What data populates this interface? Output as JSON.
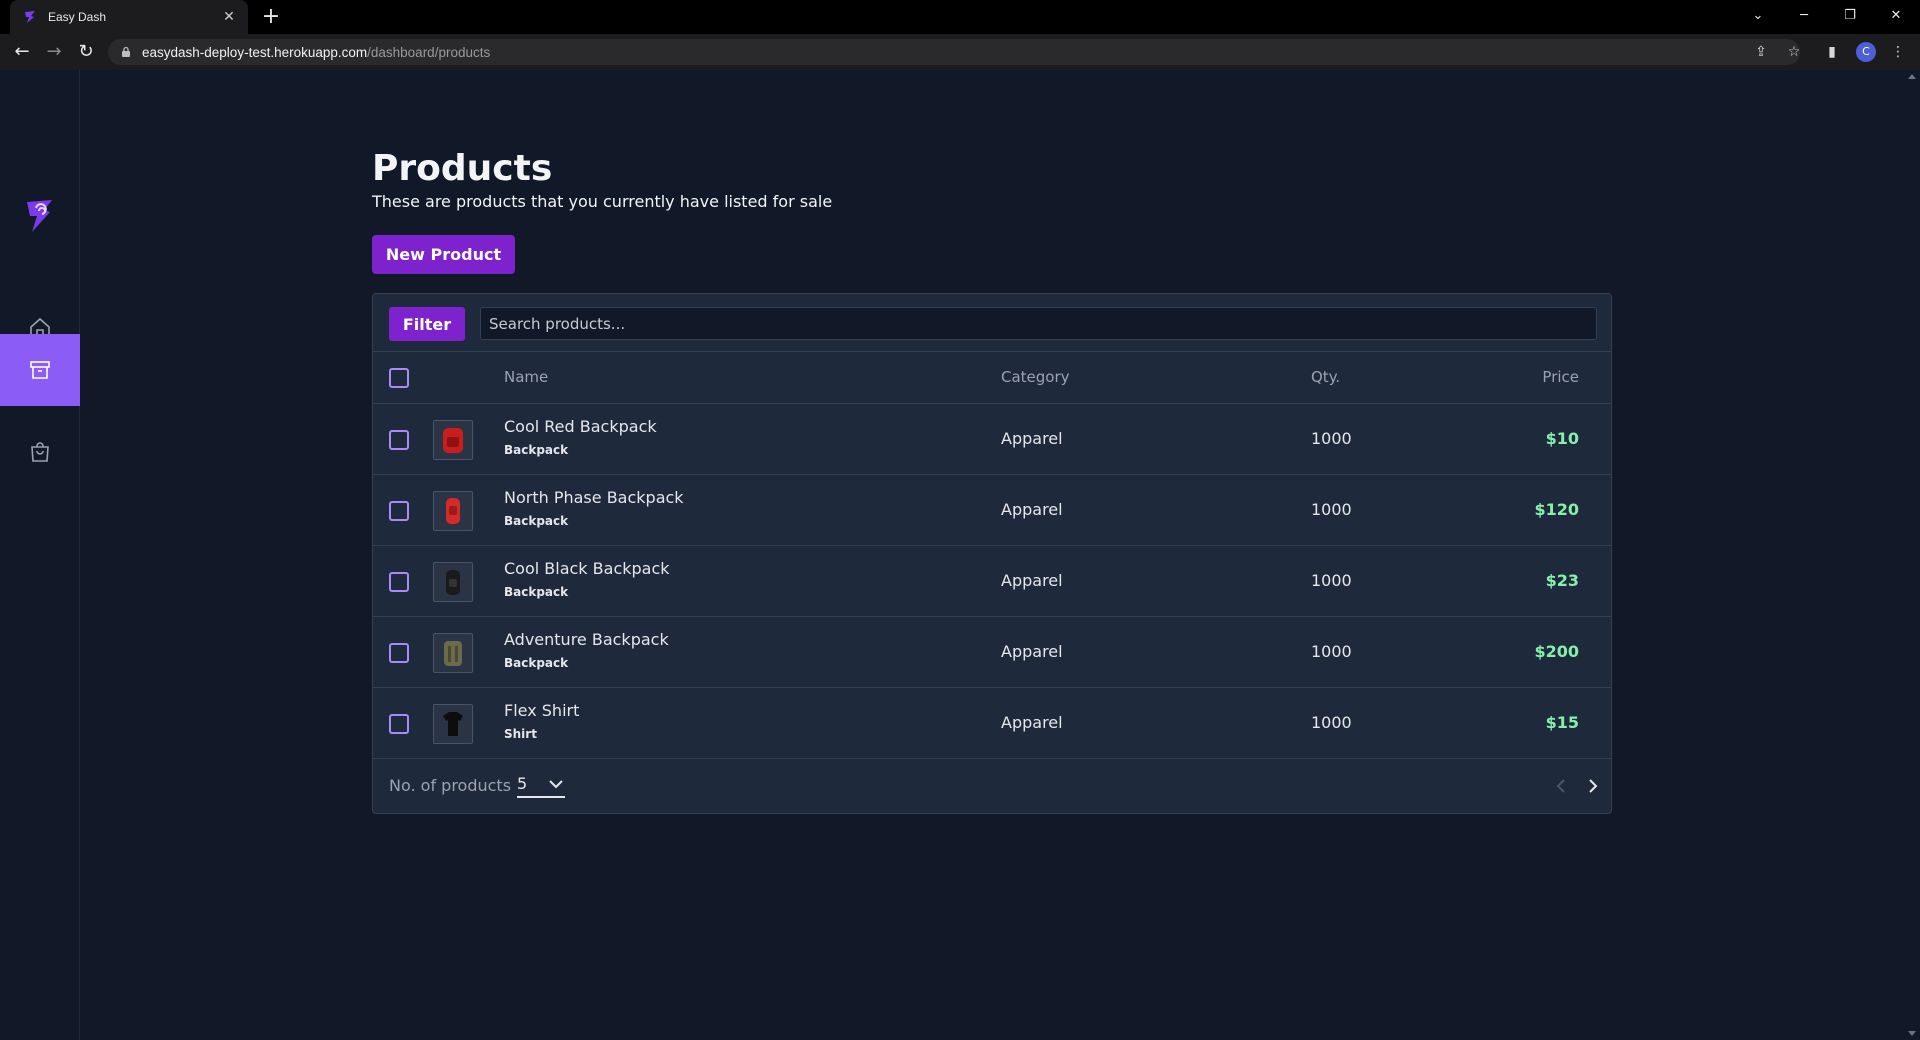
{
  "browser": {
    "tab_title": "Easy Dash",
    "url_host": "easydash-deploy-test.herokuapp.com",
    "url_path": "/dashboard/products",
    "profile_initial": "C"
  },
  "sidebar": {
    "items": [
      {
        "name": "home",
        "icon": "home-icon",
        "active": false
      },
      {
        "name": "products",
        "icon": "archive-box-icon",
        "active": true
      },
      {
        "name": "orders",
        "icon": "shopping-bag-icon",
        "active": false
      }
    ]
  },
  "page": {
    "title": "Products",
    "subtitle": "These are products that you currently have listed for sale",
    "new_button": "New Product"
  },
  "table": {
    "filter_label": "Filter",
    "search_placeholder": "Search products...",
    "headers": {
      "name": "Name",
      "category": "Category",
      "qty": "Qty.",
      "price": "Price"
    },
    "rows": [
      {
        "name": "Cool Red Backpack",
        "type": "Backpack",
        "category": "Apparel",
        "qty": "1000",
        "price": "$10",
        "thumb_color": "#c81e1e"
      },
      {
        "name": "North Phase Backpack",
        "type": "Backpack",
        "category": "Apparel",
        "qty": "1000",
        "price": "$120",
        "thumb_color": "#d42a2a"
      },
      {
        "name": "Cool Black Backpack",
        "type": "Backpack",
        "category": "Apparel",
        "qty": "1000",
        "price": "$23",
        "thumb_color": "#1a1a1a"
      },
      {
        "name": "Adventure Backpack",
        "type": "Backpack",
        "category": "Apparel",
        "qty": "1000",
        "price": "$200",
        "thumb_color": "#6b6a4a"
      },
      {
        "name": "Flex Shirt",
        "type": "Shirt",
        "category": "Apparel",
        "qty": "1000",
        "price": "$15",
        "thumb_color": "#0d0d0d"
      }
    ],
    "footer": {
      "label": "No. of products",
      "page_size": "5"
    }
  },
  "colors": {
    "accent": "#7e22ce",
    "active_nav": "#8b5cf6",
    "price": "#86efac",
    "background": "#111827",
    "card": "#1e293b"
  }
}
